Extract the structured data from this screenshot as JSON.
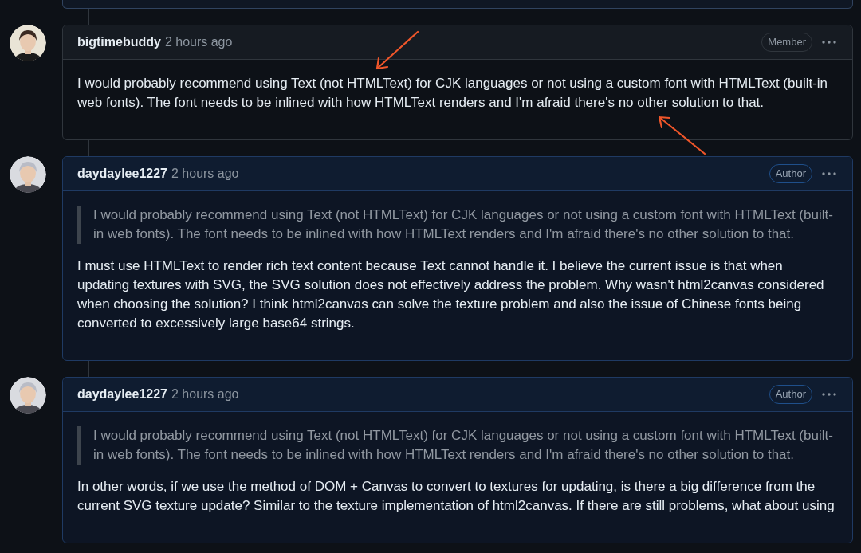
{
  "comments": [
    {
      "author": "bigtimebuddy",
      "time": "2 hours ago",
      "role": "Member",
      "highlighted": false,
      "paragraphs": [
        "I would probably recommend using Text (not HTMLText) for CJK languages or not using a custom font with HTMLText (built-in web fonts). The font needs to be inlined with how HTMLText renders and I'm afraid there's no other solution to that."
      ]
    },
    {
      "author": "daydaylee1227",
      "time": "2 hours ago",
      "role": "Author",
      "highlighted": true,
      "quote": "I would probably recommend using Text (not HTMLText) for CJK languages or not using a custom font with HTMLText (built-in web fonts). The font needs to be inlined with how HTMLText renders and I'm afraid there's no other solution to that.",
      "paragraphs": [
        "I must use HTMLText to render rich text content because Text cannot handle it. I believe the current issue is that when updating textures with SVG, the SVG solution does not effectively address the problem. Why wasn't html2canvas considered when choosing the solution? I think html2canvas can solve the texture problem and also the issue of Chinese fonts being converted to excessively large base64 strings."
      ]
    },
    {
      "author": "daydaylee1227",
      "time": "2 hours ago",
      "role": "Author",
      "highlighted": true,
      "quote": "I would probably recommend using Text (not HTMLText) for CJK languages or not using a custom font with HTMLText (built-in web fonts). The font needs to be inlined with how HTMLText renders and I'm afraid there's no other solution to that.",
      "paragraphs": [
        "In other words, if we use the method of DOM + Canvas to convert to textures for updating, is there a big difference from the current SVG texture update? Similar to the texture implementation of html2canvas. If there are still problems, what about using"
      ]
    }
  ]
}
